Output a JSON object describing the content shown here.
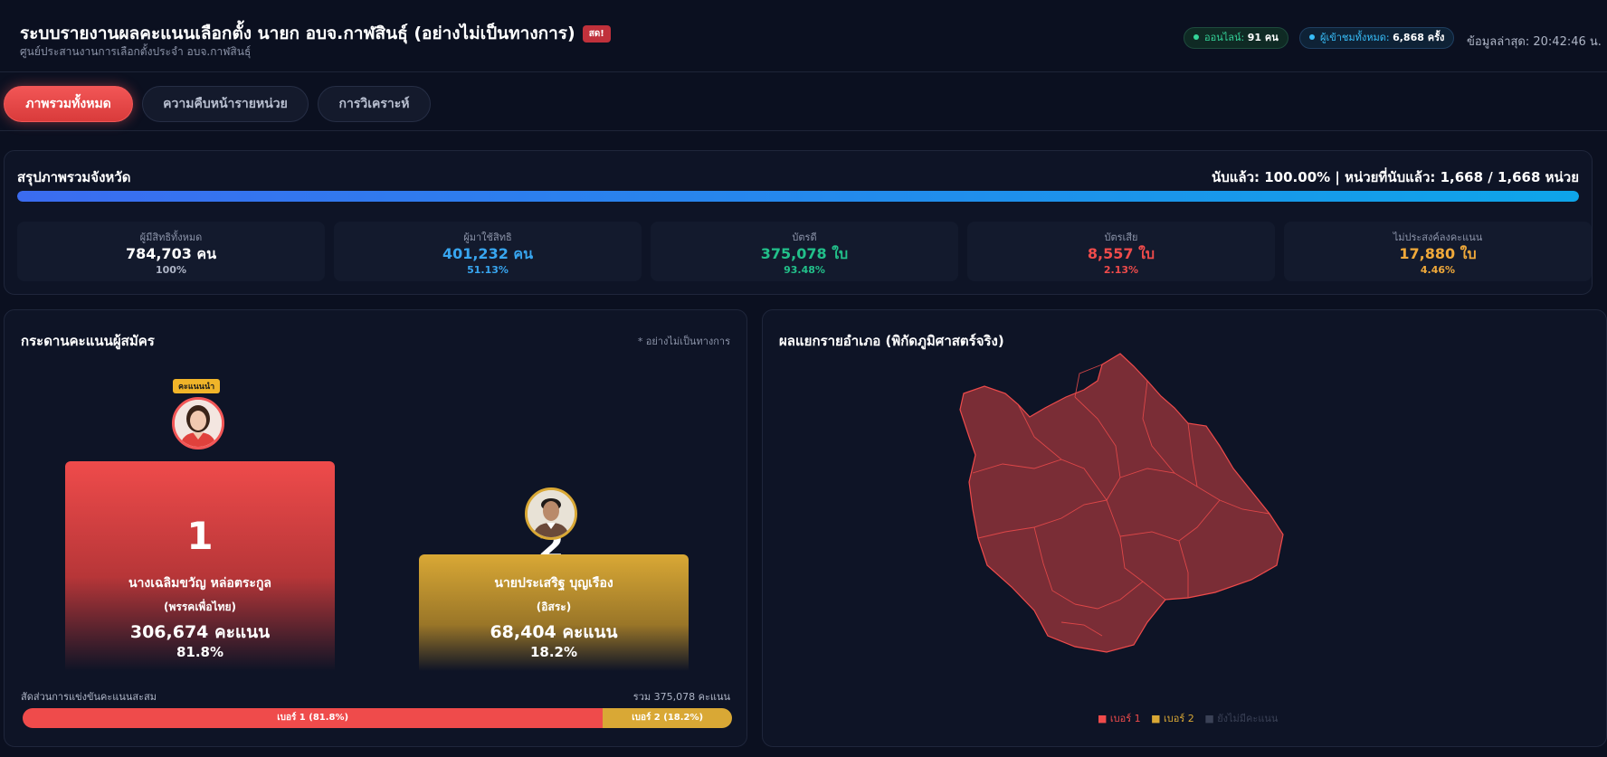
{
  "header": {
    "title": "ระบบรายงานผลคะแนนเลือกตั้ง นายก อบจ.กาฬสินธุ์ (อย่างไม่เป็นทางการ)",
    "live_badge": "สด!",
    "subtitle": "ศูนย์ประสานงานการเลือกตั้งประจำ อบจ.กาฬสินธุ์",
    "online_label": "ออนไลน์:",
    "online_value": "91 คน",
    "visits_label": "ผู้เข้าชมทั้งหมด:",
    "visits_value": "6,868 ครั้ง",
    "updated": "ข้อมูลล่าสุด: 20:42:46 น."
  },
  "tabs": [
    {
      "label": "ภาพรวมทั้งหมด",
      "active": true
    },
    {
      "label": "ความคืบหน้ารายหน่วย",
      "active": false
    },
    {
      "label": "การวิเคราะห์",
      "active": false
    }
  ],
  "summary": {
    "title": "สรุปภาพรวมจังหวัด",
    "progress_text": "นับแล้ว: 100.00% | หน่วยที่นับแล้ว: 1,668 / 1,668 หน่วย",
    "progress_fraction": 1.0,
    "stats": [
      {
        "label": "ผู้มีสิทธิทั้งหมด",
        "value": "784,703 คน",
        "pct": "100%",
        "color": "#ffffff",
        "pct_color": "#aeb5c6"
      },
      {
        "label": "ผู้มาใช้สิทธิ",
        "value": "401,232 คน",
        "pct": "51.13%",
        "color": "#38a6f0",
        "pct_color": "#38a6f0"
      },
      {
        "label": "บัตรดี",
        "value": "375,078 ใบ",
        "pct": "93.48%",
        "color": "#22c08a",
        "pct_color": "#22c08a"
      },
      {
        "label": "บัตรเสีย",
        "value": "8,557 ใบ",
        "pct": "2.13%",
        "color": "#ef4b4b",
        "pct_color": "#ef4b4b"
      },
      {
        "label": "ไม่ประสงค์ลงคะแนน",
        "value": "17,880 ใบ",
        "pct": "4.46%",
        "color": "#f0a93a",
        "pct_color": "#f0a93a"
      }
    ]
  },
  "board": {
    "title": "กระดานคะแนนผู้สมัคร",
    "note": "* อย่างไม่เป็นทางการ",
    "lead_badge": "คะแนนนำ",
    "candidates": [
      {
        "rank": "1",
        "name": "นางเฉลิมขวัญ หล่อตระกูล",
        "party": "(พรรคเพื่อไทย)",
        "votes": "306,674 คะแนน",
        "pct": "81.8%",
        "share": 0.818,
        "color": "#ef4b4b"
      },
      {
        "rank": "2",
        "name": "นายประเสริฐ บุญเรือง",
        "party": "(อิสระ)",
        "votes": "68,404 คะแนน",
        "pct": "18.2%",
        "share": 0.182,
        "color": "#d9a835"
      }
    ],
    "share_label": "สัดส่วนการแข่งขันคะแนนสะสม",
    "share_total": "รวม 375,078 คะแนน",
    "seg1_label": "เบอร์ 1 (81.8%)",
    "seg2_label": "เบอร์ 2 (18.2%)"
  },
  "map": {
    "title": "ผลแยกรายอำเภอ (พิกัดภูมิศาสตร์จริง)",
    "fill_color": "#7a2d36",
    "border_color": "#ef4b4b",
    "legend": [
      {
        "label": "■ เบอร์ 1"
      },
      {
        "label": "■ เบอร์ 2"
      },
      {
        "label": "■ ยังไม่มีคะแนน"
      }
    ]
  }
}
